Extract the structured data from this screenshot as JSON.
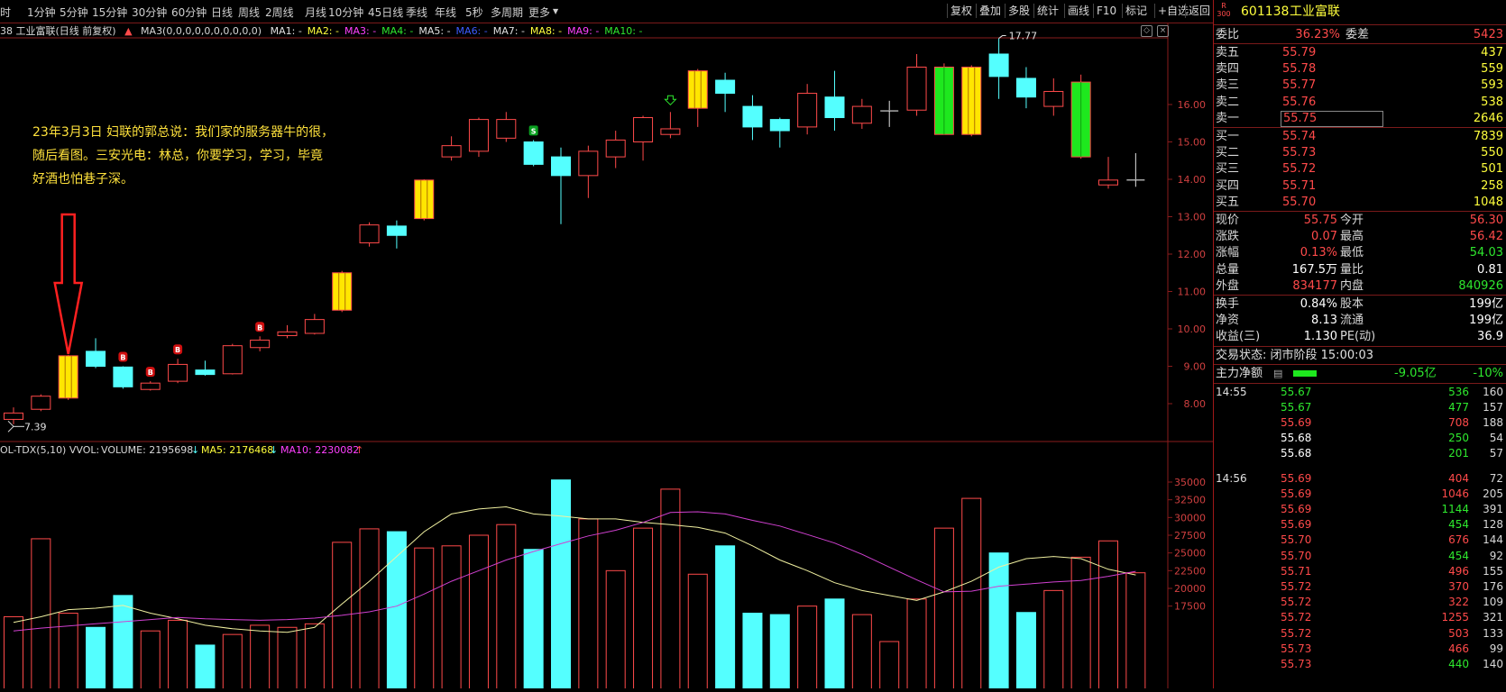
{
  "toolbar": {
    "periods": [
      "分时",
      "1分钟",
      "5分钟",
      "15分钟",
      "30分钟",
      "60分钟",
      "日线",
      "周线",
      "2周线",
      "月线",
      "10分钟",
      "45日线",
      "季线",
      "年线",
      "5秒",
      "多周期",
      "更多"
    ],
    "right_buttons": [
      "复权",
      "叠加",
      "多股",
      "统计",
      "画线",
      "F10",
      "标记",
      "+自选",
      "返回"
    ]
  },
  "info_line": {
    "stock": "38 工业富联(日线 前复权)",
    "ma3": "MA3(0,0,0,0,0,0,0,0,0,0)",
    "mas": [
      {
        "label": "MA1: -",
        "color": "#e0e0e0"
      },
      {
        "label": "MA2: -",
        "color": "#ffff3c"
      },
      {
        "label": "MA3: -",
        "color": "#ff40ff"
      },
      {
        "label": "MA4: -",
        "color": "#2ee82e"
      },
      {
        "label": "MA5: -",
        "color": "#e0e0e0"
      },
      {
        "label": "MA6: -",
        "color": "#3c5cff"
      },
      {
        "label": "MA7: -",
        "color": "#e0e0e0"
      },
      {
        "label": "MA8: -",
        "color": "#ffff3c"
      },
      {
        "label": "MA9: -",
        "color": "#ff40ff"
      },
      {
        "label": "MA10: -",
        "color": "#2ee82e"
      }
    ]
  },
  "annotation": {
    "lines": [
      "23年3月3日 妇联的郭总说：我们家的服务器牛的很，",
      "随后看图。三安光电：林总，你要学习，学习，毕竟",
      "好酒也怕巷子深。"
    ]
  },
  "colors": {
    "up": "#ff4a4a",
    "down": "#54ffff",
    "highlight": "#ffe600",
    "green_bar": "#1ee81e",
    "grid": "#8a1c1c",
    "axis_text": "#d04040"
  },
  "chart_data": {
    "type": "candlestick",
    "price_ticks": [
      "16.00",
      "15.00",
      "14.00",
      "13.00",
      "12.00",
      "11.00",
      "10.00",
      "9.00",
      "8.00"
    ],
    "max_label": "17.77",
    "min_label": "7.39",
    "candles": [
      {
        "o": 7.58,
        "c": 7.75,
        "h": 7.9,
        "l": 7.45,
        "t": "up"
      },
      {
        "o": 7.85,
        "c": 8.2,
        "h": 8.25,
        "l": 7.8,
        "t": "up"
      },
      {
        "o": 8.15,
        "c": 9.28,
        "h": 9.3,
        "l": 8.1,
        "t": "hl"
      },
      {
        "o": 9.4,
        "c": 9.0,
        "h": 9.75,
        "l": 8.95,
        "t": "dn"
      },
      {
        "o": 8.98,
        "c": 8.45,
        "h": 9.0,
        "l": 8.4,
        "t": "dn",
        "m": "B"
      },
      {
        "o": 8.38,
        "c": 8.55,
        "h": 8.6,
        "l": 8.35,
        "t": "up",
        "m": "B"
      },
      {
        "o": 8.6,
        "c": 9.05,
        "h": 9.2,
        "l": 8.55,
        "t": "up",
        "m": "B"
      },
      {
        "o": 8.9,
        "c": 8.78,
        "h": 9.15,
        "l": 8.75,
        "t": "dn"
      },
      {
        "o": 8.8,
        "c": 9.55,
        "h": 9.6,
        "l": 8.78,
        "t": "up"
      },
      {
        "o": 9.5,
        "c": 9.7,
        "h": 9.8,
        "l": 9.4,
        "t": "up",
        "m": "B"
      },
      {
        "o": 9.82,
        "c": 9.92,
        "h": 10.1,
        "l": 9.75,
        "t": "up"
      },
      {
        "o": 9.88,
        "c": 10.25,
        "h": 10.4,
        "l": 9.85,
        "t": "up"
      },
      {
        "o": 10.5,
        "c": 11.5,
        "h": 11.55,
        "l": 10.45,
        "t": "hl"
      },
      {
        "o": 12.3,
        "c": 12.78,
        "h": 12.85,
        "l": 12.2,
        "t": "up"
      },
      {
        "o": 12.75,
        "c": 12.5,
        "h": 12.9,
        "l": 12.15,
        "t": "dn"
      },
      {
        "o": 12.95,
        "c": 13.98,
        "h": 14.0,
        "l": 12.9,
        "t": "hl"
      },
      {
        "o": 14.6,
        "c": 14.9,
        "h": 15.15,
        "l": 14.5,
        "t": "up"
      },
      {
        "o": 14.75,
        "c": 15.6,
        "h": 15.65,
        "l": 14.6,
        "t": "up"
      },
      {
        "o": 15.1,
        "c": 15.6,
        "h": 15.8,
        "l": 15.0,
        "t": "up"
      },
      {
        "o": 15.0,
        "c": 14.4,
        "h": 15.05,
        "l": 14.35,
        "t": "dn",
        "m": "S"
      },
      {
        "o": 14.6,
        "c": 14.1,
        "h": 14.85,
        "l": 12.8,
        "t": "dn"
      },
      {
        "o": 14.1,
        "c": 14.75,
        "h": 14.9,
        "l": 13.5,
        "t": "up"
      },
      {
        "o": 14.6,
        "c": 15.05,
        "h": 15.3,
        "l": 14.3,
        "t": "up"
      },
      {
        "o": 15.0,
        "c": 15.65,
        "h": 15.7,
        "l": 14.5,
        "t": "up"
      },
      {
        "o": 15.2,
        "c": 15.35,
        "h": 15.8,
        "l": 15.1,
        "t": "up",
        "m": "arrow"
      },
      {
        "o": 15.9,
        "c": 16.9,
        "h": 16.95,
        "l": 15.4,
        "t": "hl"
      },
      {
        "o": 16.65,
        "c": 16.3,
        "h": 16.85,
        "l": 15.8,
        "t": "dn"
      },
      {
        "o": 15.95,
        "c": 15.4,
        "h": 16.25,
        "l": 15.05,
        "t": "dn"
      },
      {
        "o": 15.6,
        "c": 15.3,
        "h": 15.65,
        "l": 14.85,
        "t": "dn"
      },
      {
        "o": 15.4,
        "c": 16.3,
        "h": 16.55,
        "l": 15.2,
        "t": "up"
      },
      {
        "o": 16.2,
        "c": 15.65,
        "h": 16.9,
        "l": 15.3,
        "t": "dn"
      },
      {
        "o": 15.5,
        "c": 15.95,
        "h": 16.15,
        "l": 15.35,
        "t": "up"
      },
      {
        "o": 15.83,
        "c": 15.85,
        "h": 16.1,
        "l": 15.4,
        "t": "dojiw"
      },
      {
        "o": 15.85,
        "c": 17.0,
        "h": 17.35,
        "l": 15.7,
        "t": "up"
      },
      {
        "o": 17.0,
        "c": 15.2,
        "h": 17.1,
        "l": 15.2,
        "t": "gn"
      },
      {
        "o": 15.2,
        "c": 17.0,
        "h": 17.05,
        "l": 15.15,
        "t": "hl"
      },
      {
        "o": 17.35,
        "c": 16.75,
        "h": 17.77,
        "l": 16.15,
        "t": "dn"
      },
      {
        "o": 16.7,
        "c": 16.2,
        "h": 17.0,
        "l": 15.9,
        "t": "dn"
      },
      {
        "o": 15.95,
        "c": 16.35,
        "h": 16.7,
        "l": 15.7,
        "t": "up"
      },
      {
        "o": 16.6,
        "c": 14.6,
        "h": 16.8,
        "l": 14.55,
        "t": "gn"
      },
      {
        "o": 13.85,
        "c": 13.98,
        "h": 14.6,
        "l": 13.75,
        "t": "up"
      },
      {
        "o": 13.98,
        "c": 14.0,
        "h": 14.7,
        "l": 13.8,
        "t": "dojiw"
      }
    ],
    "volume": {
      "label": "OL-TDX(5,10) VVOL:",
      "volume_text": "VOLUME: 2195698",
      "ma5_text": "MA5: 2176468",
      "ma10_text": "MA10: 2230082",
      "ticks": [
        "35000",
        "32500",
        "30000",
        "27500",
        "25000",
        "22500",
        "20000",
        "17500"
      ],
      "bars": [
        16000,
        27000,
        16500,
        14500,
        19000,
        14000,
        15500,
        12000,
        13500,
        14800,
        14500,
        15000,
        26500,
        28400,
        28000,
        25700,
        26000,
        27500,
        29000,
        25500,
        35300,
        29800,
        22500,
        28500,
        34000,
        22000,
        26000,
        16500,
        16300,
        17500,
        18500,
        16300,
        12500,
        18500,
        28500,
        32700,
        25000,
        16600,
        19700,
        24400,
        26700,
        22200
      ],
      "ma5": [
        15200,
        16000,
        17000,
        17200,
        17600,
        16500,
        15700,
        14800,
        14300,
        14000,
        13800,
        14500,
        17800,
        21000,
        24500,
        28000,
        30500,
        31200,
        31500,
        30500,
        30200,
        29800,
        29800,
        29300,
        29000,
        28600,
        27800,
        26000,
        24000,
        22500,
        20800,
        19700,
        19000,
        18300,
        19500,
        21000,
        23000,
        24200,
        24500,
        24200,
        22700,
        21900
      ],
      "ma10": [
        14000,
        14400,
        14700,
        15000,
        15300,
        15600,
        15900,
        15700,
        15600,
        15500,
        15600,
        15800,
        16200,
        16700,
        17500,
        19200,
        21000,
        22500,
        24000,
        25200,
        26300,
        27400,
        28200,
        29300,
        30700,
        30800,
        30500,
        29600,
        28800,
        27600,
        26400,
        24800,
        23000,
        21200,
        19500,
        19600,
        20300,
        20600,
        20900,
        21100,
        21700,
        22400
      ]
    }
  },
  "quote_panel": {
    "marker": "R\n300",
    "code": "601138",
    "name": "工业富联",
    "weibi_label": "委比",
    "weibi_value": "36.23%",
    "weicha_label": "委差",
    "weicha_value": "5423",
    "sells": [
      {
        "label": "卖五",
        "price": "55.79",
        "vol": "437"
      },
      {
        "label": "卖四",
        "price": "55.78",
        "vol": "559"
      },
      {
        "label": "卖三",
        "price": "55.77",
        "vol": "593"
      },
      {
        "label": "卖二",
        "price": "55.76",
        "vol": "538"
      },
      {
        "label": "卖一",
        "price": "55.75",
        "vol": "2646"
      }
    ],
    "buys": [
      {
        "label": "买一",
        "price": "55.74",
        "vol": "7839"
      },
      {
        "label": "买二",
        "price": "55.73",
        "vol": "550"
      },
      {
        "label": "买三",
        "price": "55.72",
        "vol": "501"
      },
      {
        "label": "买四",
        "price": "55.71",
        "vol": "258"
      },
      {
        "label": "买五",
        "price": "55.70",
        "vol": "1048"
      }
    ],
    "stats": [
      {
        "l1": "现价",
        "v1": "55.75",
        "c1": "red",
        "l2": "今开",
        "v2": "56.30",
        "c2": "red"
      },
      {
        "l1": "涨跌",
        "v1": "0.07",
        "c1": "red",
        "l2": "最高",
        "v2": "56.42",
        "c2": "red"
      },
      {
        "l1": "涨幅",
        "v1": "0.13%",
        "c1": "red",
        "l2": "最低",
        "v2": "54.03",
        "c2": "green"
      },
      {
        "l1": "总量",
        "v1": "167.5万",
        "c1": "white",
        "l2": "量比",
        "v2": "0.81",
        "c2": "white"
      },
      {
        "l1": "外盘",
        "v1": "834177",
        "c1": "red",
        "l2": "内盘",
        "v2": "840926",
        "c2": "green"
      },
      {
        "l1": "换手",
        "v1": "0.84%",
        "c1": "white",
        "l2": "股本",
        "v2": "199亿",
        "c2": "white"
      },
      {
        "l1": "净资",
        "v1": "8.13",
        "c1": "white",
        "l2": "流通",
        "v2": "199亿",
        "c2": "white"
      },
      {
        "l1": "收益(三)",
        "v1": "1.130",
        "c1": "white",
        "l2": "PE(动)",
        "v2": "36.9",
        "c2": "white"
      }
    ],
    "trade_status": "交易状态: 闭市阶段 15:00:03",
    "main_net_label": "主力净额",
    "main_net_value": "-9.05亿",
    "main_net_pct": "-10%",
    "ticks": [
      {
        "time": "14:55",
        "price": "55.67",
        "pc": "green",
        "vol": "536",
        "vc": "green",
        "n": "160"
      },
      {
        "time": "",
        "price": "55.67",
        "pc": "green",
        "vol": "477",
        "vc": "green",
        "n": "157"
      },
      {
        "time": "",
        "price": "55.69",
        "pc": "red",
        "vol": "708",
        "vc": "red",
        "n": "188"
      },
      {
        "time": "",
        "price": "55.68",
        "pc": "white",
        "vol": "250",
        "vc": "green",
        "n": "54"
      },
      {
        "time": "",
        "price": "55.68",
        "pc": "white",
        "vol": "201",
        "vc": "green",
        "n": "57"
      },
      {
        "time": "14:56",
        "price": "55.69",
        "pc": "red",
        "vol": "404",
        "vc": "red",
        "n": "72"
      },
      {
        "time": "",
        "price": "55.69",
        "pc": "red",
        "vol": "1046",
        "vc": "red",
        "n": "205"
      },
      {
        "time": "",
        "price": "55.69",
        "pc": "red",
        "vol": "1144",
        "vc": "green",
        "n": "391"
      },
      {
        "time": "",
        "price": "55.69",
        "pc": "red",
        "vol": "454",
        "vc": "green",
        "n": "128"
      },
      {
        "time": "",
        "price": "55.70",
        "pc": "red",
        "vol": "676",
        "vc": "red",
        "n": "144"
      },
      {
        "time": "",
        "price": "55.70",
        "pc": "red",
        "vol": "454",
        "vc": "green",
        "n": "92"
      },
      {
        "time": "",
        "price": "55.71",
        "pc": "red",
        "vol": "496",
        "vc": "red",
        "n": "155"
      },
      {
        "time": "",
        "price": "55.72",
        "pc": "red",
        "vol": "370",
        "vc": "red",
        "n": "176"
      },
      {
        "time": "",
        "price": "55.72",
        "pc": "red",
        "vol": "322",
        "vc": "red",
        "n": "109"
      },
      {
        "time": "",
        "price": "55.72",
        "pc": "red",
        "vol": "1255",
        "vc": "red",
        "n": "321"
      },
      {
        "time": "",
        "price": "55.72",
        "pc": "red",
        "vol": "503",
        "vc": "red",
        "n": "133"
      },
      {
        "time": "",
        "price": "55.73",
        "pc": "red",
        "vol": "466",
        "vc": "red",
        "n": "99"
      },
      {
        "time": "",
        "price": "55.73",
        "pc": "red",
        "vol": "440",
        "vc": "green",
        "n": "140"
      }
    ]
  }
}
